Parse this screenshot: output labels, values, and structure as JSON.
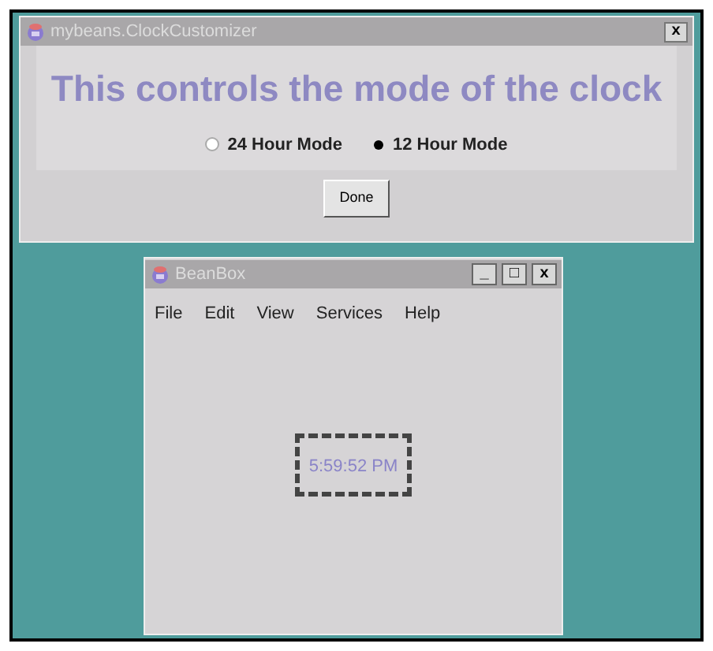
{
  "customizer_window": {
    "title": "mybeans.ClockCustomizer",
    "close_button": "x",
    "heading": "This controls the mode of the clock",
    "modes": [
      {
        "label": "24 Hour Mode",
        "selected": false
      },
      {
        "label": "12 Hour Mode",
        "selected": true
      }
    ],
    "done_button": "Done"
  },
  "beanbox_window": {
    "title": "BeanBox",
    "controls": [
      "_",
      "□",
      "x"
    ],
    "menu": [
      "File",
      "Edit",
      "View",
      "Services",
      "Help"
    ],
    "clock": {
      "time": "5:59:52 PM",
      "selected": true
    }
  }
}
